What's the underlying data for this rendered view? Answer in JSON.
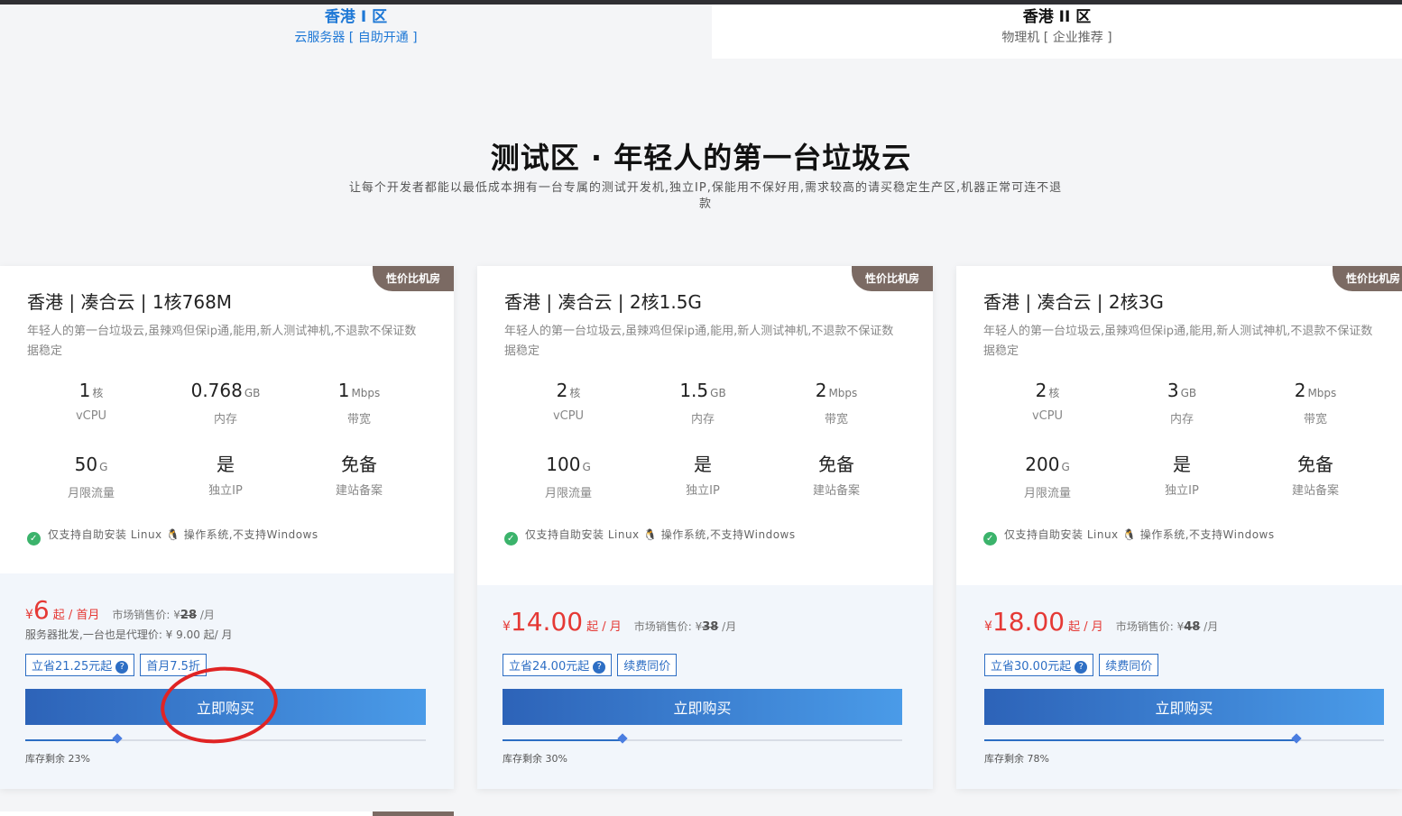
{
  "tabs": [
    {
      "title": "香港 I 区",
      "subtitle": "云服务器 [ 自助开通 ]"
    },
    {
      "title": "香港 II 区",
      "subtitle": "物理机 [ 企业推荐 ]"
    }
  ],
  "section": {
    "title": "测试区 · 年轻人的第一台垃圾云",
    "description": "让每个开发者都能以最低成本拥有一台专属的测试开发机,独立IP,保能用不保好用,需求较高的请买稳定生产区,机器正常可连不退款"
  },
  "colors": {
    "accent": "#1e78d6",
    "price": "#e53935",
    "ribbon": "#7b6a63",
    "check": "#3bb36b"
  },
  "cards": [
    {
      "ribbon": "性价比机房",
      "title": "香港 | 凑合云 | 1核768M",
      "desc": "年轻人的第一台垃圾云,虽辣鸡但保ip通,能用,新人测试神机,不退款不保证数据稳定",
      "specs": [
        {
          "value": "1",
          "unit": "核",
          "label": "vCPU"
        },
        {
          "value": "0.768",
          "unit": "GB",
          "label": "内存"
        },
        {
          "value": "1",
          "unit": "Mbps",
          "label": "带宽"
        },
        {
          "value": "50",
          "unit": "G",
          "label": "月限流量"
        },
        {
          "value": "是",
          "unit": "",
          "label": "独立IP"
        },
        {
          "value": "免备",
          "unit": "",
          "label": "建站备案"
        }
      ],
      "os_note": "仅支持自助安装 Linux 🐧 操作系统,不支持Windows",
      "currency": "¥",
      "price": "6",
      "per": "起 / 首月",
      "market_prefix": "市场销售价: ¥",
      "market_price": "28",
      "market_suffix": " /月",
      "wholesale": "服务器批发,一台也是代理价: ¥ 9.00 起/ 月",
      "tags": [
        "立省21.25元起",
        "首月7.5折"
      ],
      "buy_label": "立即购买",
      "stock_label": "库存剩余 23%",
      "stock": 0.23
    },
    {
      "ribbon": "性价比机房",
      "title": "香港 | 凑合云 | 2核1.5G",
      "desc": "年轻人的第一台垃圾云,虽辣鸡但保ip通,能用,新人测试神机,不退款不保证数据稳定",
      "specs": [
        {
          "value": "2",
          "unit": "核",
          "label": "vCPU"
        },
        {
          "value": "1.5",
          "unit": "GB",
          "label": "内存"
        },
        {
          "value": "2",
          "unit": "Mbps",
          "label": "带宽"
        },
        {
          "value": "100",
          "unit": "G",
          "label": "月限流量"
        },
        {
          "value": "是",
          "unit": "",
          "label": "独立IP"
        },
        {
          "value": "免备",
          "unit": "",
          "label": "建站备案"
        }
      ],
      "os_note": "仅支持自助安装 Linux 🐧 操作系统,不支持Windows",
      "currency": "¥",
      "price": "14.00",
      "per": "起 / 月",
      "market_prefix": "市场销售价: ¥",
      "market_price": "38",
      "market_suffix": " /月",
      "tags": [
        "立省24.00元起",
        "续费同价"
      ],
      "buy_label": "立即购买",
      "stock_label": "库存剩余 30%",
      "stock": 0.3
    },
    {
      "ribbon": "性价比机房",
      "title": "香港 | 凑合云 | 2核3G",
      "desc": "年轻人的第一台垃圾云,虽辣鸡但保ip通,能用,新人测试神机,不退款不保证数据稳定",
      "specs": [
        {
          "value": "2",
          "unit": "核",
          "label": "vCPU"
        },
        {
          "value": "3",
          "unit": "GB",
          "label": "内存"
        },
        {
          "value": "2",
          "unit": "Mbps",
          "label": "带宽"
        },
        {
          "value": "200",
          "unit": "G",
          "label": "月限流量"
        },
        {
          "value": "是",
          "unit": "",
          "label": "独立IP"
        },
        {
          "value": "免备",
          "unit": "",
          "label": "建站备案"
        }
      ],
      "os_note": "仅支持自助安装 Linux 🐧 操作系统,不支持Windows",
      "currency": "¥",
      "price": "18.00",
      "per": "起 / 月",
      "market_prefix": "市场销售价: ¥",
      "market_price": "48",
      "market_suffix": " /月",
      "tags": [
        "立省30.00元起",
        "续费同价"
      ],
      "buy_label": "立即购买",
      "stock_label": "库存剩余 78%",
      "stock": 0.78
    }
  ]
}
